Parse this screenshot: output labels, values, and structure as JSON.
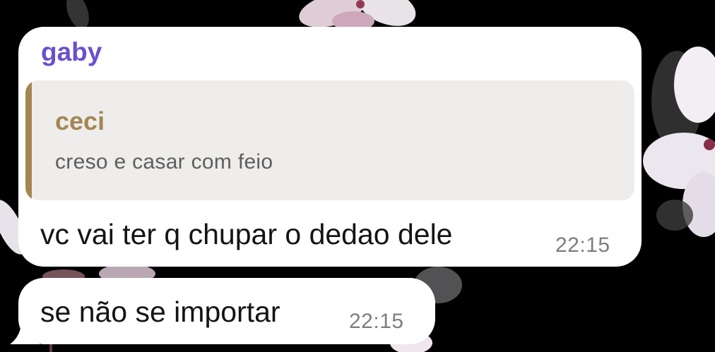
{
  "chat": {
    "messages": [
      {
        "sender": "gaby",
        "reply": {
          "author": "ceci",
          "text": "creso e casar com feio"
        },
        "text": "vc vai ter q chupar o dedao dele",
        "time": "22:15"
      },
      {
        "text": "se não se importar",
        "time": "22:15"
      }
    ]
  },
  "colors": {
    "sender_name": "#6a4fcf",
    "reply_accent": "#a58552",
    "reply_background": "#eeedec",
    "bubble": "#ffffff",
    "wallpaper": "#000000"
  },
  "icons": {
    "wallpaper": "flower-wallpaper"
  }
}
